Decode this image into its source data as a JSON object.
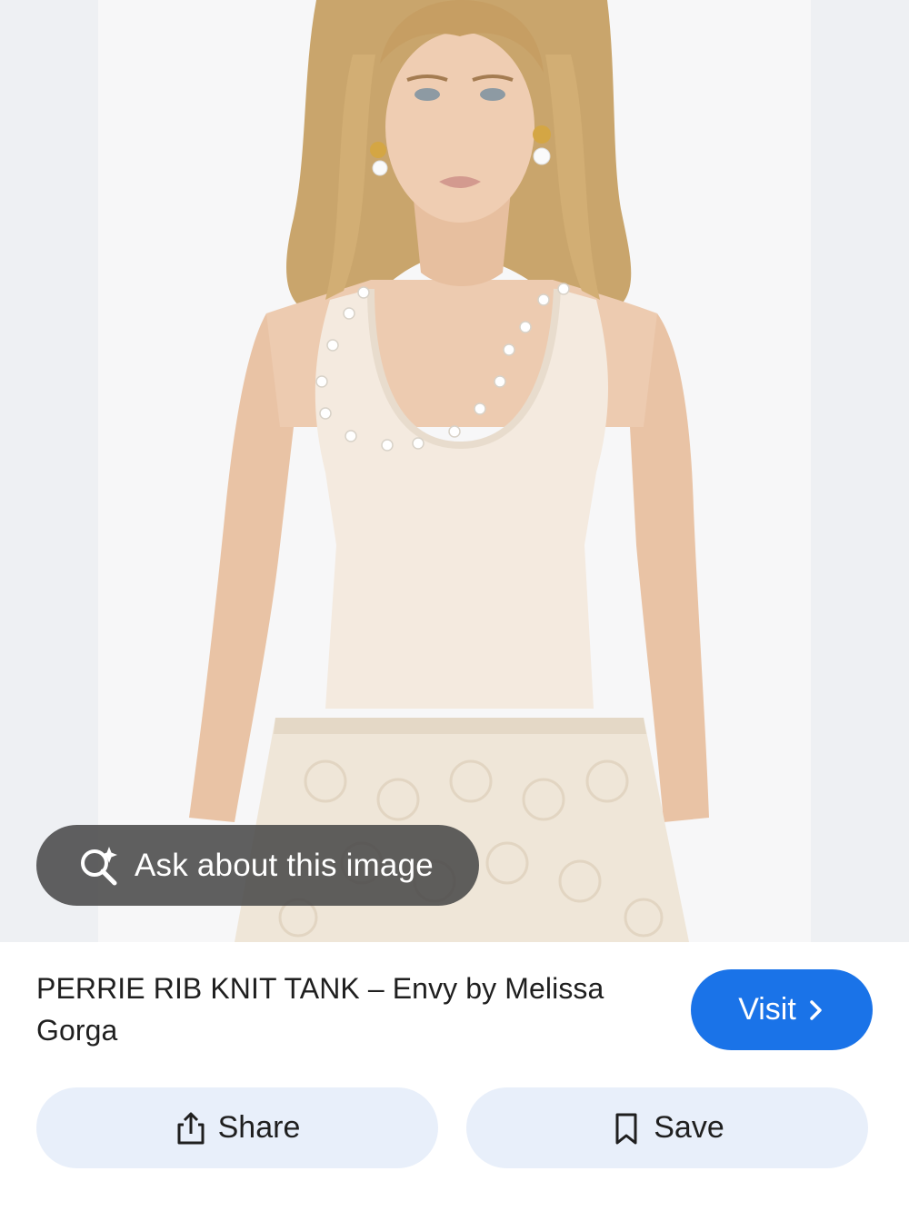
{
  "ask": {
    "label": "Ask about this image",
    "icon": "lens-sparkle-icon"
  },
  "result": {
    "title": "PERRIE RIB KNIT TANK – Envy by Melissa Gorga"
  },
  "visit": {
    "label": "Visit",
    "icon": "chevron-right-icon",
    "color": "#1a73e8"
  },
  "actions": {
    "share": {
      "label": "Share",
      "icon": "share-icon"
    },
    "save": {
      "label": "Save",
      "icon": "bookmark-icon"
    }
  },
  "colors": {
    "action_bg": "#e8effa",
    "pill_bg": "#464646"
  }
}
